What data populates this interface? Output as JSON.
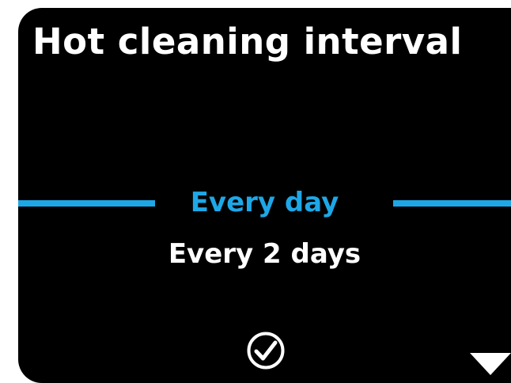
{
  "screen": {
    "title": "Hot cleaning interval",
    "options": [
      {
        "label": "Every day",
        "selected": true
      },
      {
        "label": "Every 2 days",
        "selected": false
      }
    ],
    "confirm_icon": "checkmark-circle-icon",
    "scroll_icon": "triangle-down-icon",
    "colors": {
      "background": "#000000",
      "accent": "#1ea7e6",
      "text": "#ffffff"
    }
  }
}
